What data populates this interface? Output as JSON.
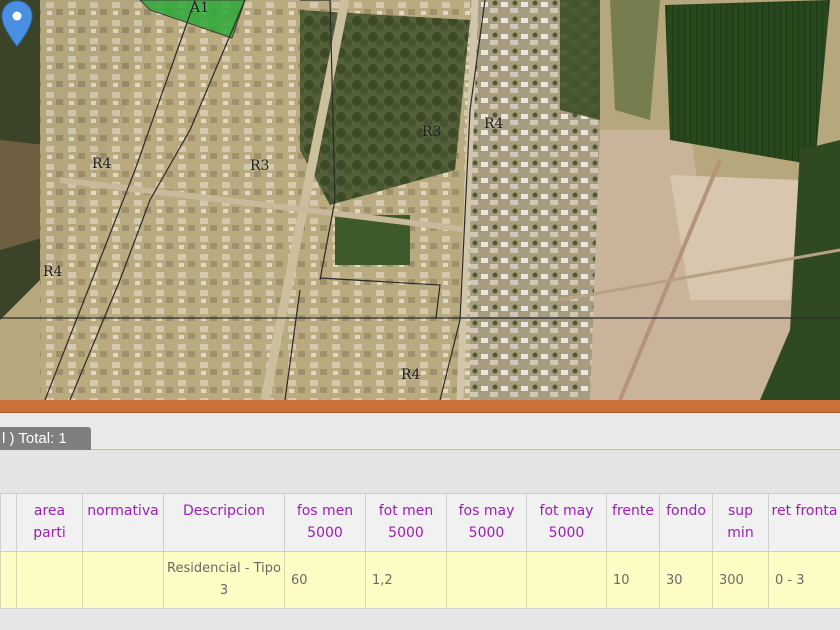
{
  "map": {
    "zone_labels": [
      "A1",
      "R4",
      "R3",
      "R3",
      "R4",
      "R4",
      "R4"
    ],
    "pin_color": "#4a90e2",
    "colors": {
      "urban": "#b7a77c",
      "field": "#2f4f1f",
      "field_dark": "#1e3c16",
      "bare_soil": "#c9b39a",
      "vegetation": "#3b4f26",
      "zone_border": "#2a2a2a",
      "zone_a1": "#2eaa3a"
    }
  },
  "panel": {
    "divider_color": "#c9703b",
    "tab_label": "l ) Total: 1",
    "columns": [
      "",
      "area parti",
      "normativa",
      "Descripcion",
      "fos men 5000",
      "fot men 5000",
      "fos may 5000",
      "fot may 5000",
      "frente",
      "fondo",
      "sup min",
      "ret fronta"
    ],
    "rows": [
      [
        "",
        "",
        "",
        "Residencial - Tipo 3",
        "60",
        "1,2",
        "",
        "",
        "10",
        "30",
        "300",
        "0 - 3"
      ]
    ],
    "header_color": "#9c1fb4",
    "row_color": "#fcfcc4"
  }
}
